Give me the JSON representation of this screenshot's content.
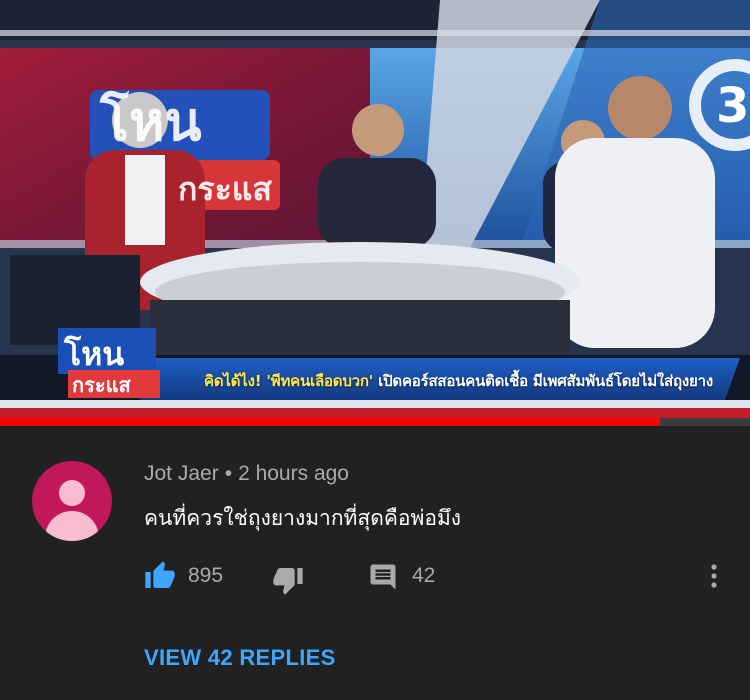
{
  "video": {
    "ticker": {
      "highlight": "คิดได้ไง! 'พีทคนเลือดบวก'",
      "rest": " เปิดคอร์สสอนคนติดเชื้อ มีเพศสัมพันธ์โดยไม่ใส่ถุงยาง"
    },
    "show_logo_top": "โหน",
    "show_logo_bottom": "กระแส",
    "channel_mark": "3",
    "progress_fraction": 0.88
  },
  "comment": {
    "author": "Jot Jaer",
    "separator": "•",
    "time": "2 hours ago",
    "text": "คนที่ควรใช่ถุงยางมากที่สุดคือพ่อมึง",
    "likes": "895",
    "reply_count": "42",
    "view_replies": "VIEW 42 REPLIES"
  },
  "colors": {
    "background": "#212121",
    "avatar": "#c2185b",
    "link": "#3ea6ff",
    "secondary_text": "#aaaaaa",
    "progress": "#ff0000"
  },
  "icons": {
    "like": "thumb-up-icon",
    "dislike": "thumb-down-icon",
    "reply": "comment-icon",
    "more": "more-vert-icon"
  }
}
